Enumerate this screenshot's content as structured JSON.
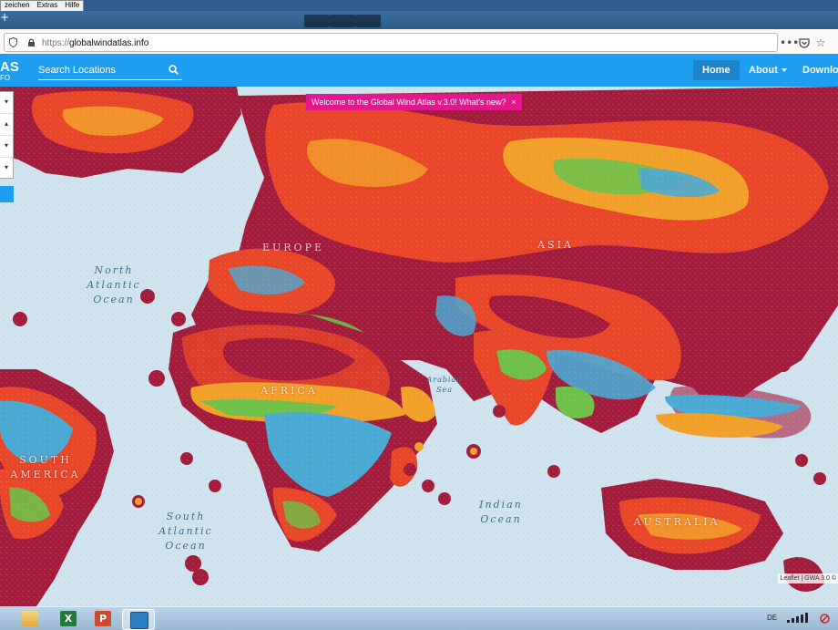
{
  "os_menu": {
    "items": [
      "zeichen",
      "Extras",
      "Hilfe"
    ]
  },
  "browser": {
    "url_protocol": "https://",
    "url_host": "globalwindatlas.info"
  },
  "app": {
    "logo_main": "AS",
    "logo_sub": "FO",
    "search_placeholder": "Search Locations",
    "nav": [
      {
        "label": "Home",
        "active": true
      },
      {
        "label": "About",
        "dropdown": true
      },
      {
        "label": "Downlo"
      }
    ]
  },
  "banner": {
    "text": "Welcome to the Global Wind Atlas v.3.0! What's new?",
    "close": "×"
  },
  "map": {
    "labels": {
      "north_atlantic": [
        "North",
        "Atlantic",
        "Ocean"
      ],
      "europe": "EUROPE",
      "asia": "ASIA",
      "africa": "AFRICA",
      "arabian_sea": [
        "Arabian",
        "Sea"
      ],
      "south_america": [
        "SOUTH",
        "AMERICA"
      ],
      "south_atlantic": [
        "South",
        "Atlantic",
        "Ocean"
      ],
      "indian_ocean": [
        "Indian",
        "Ocean"
      ],
      "australia": "AUSTRALIA"
    },
    "attribution": "Leaflet | GWA 3.0 ©"
  },
  "colors": {
    "header": "#1e9ef0",
    "banner": "#e6178e",
    "ocean": "#cfe3f2",
    "low_wind": "#a31a3f",
    "mid_wind": "#e8452a",
    "high_wind": "#f3a02a",
    "very_high_wind": "#4aa9d6"
  },
  "taskbar": {
    "apps": [
      "file-explorer-icon",
      "excel-icon",
      "powerpoint-icon",
      "remote-desktop-icon"
    ],
    "tray_lang": "DE"
  }
}
